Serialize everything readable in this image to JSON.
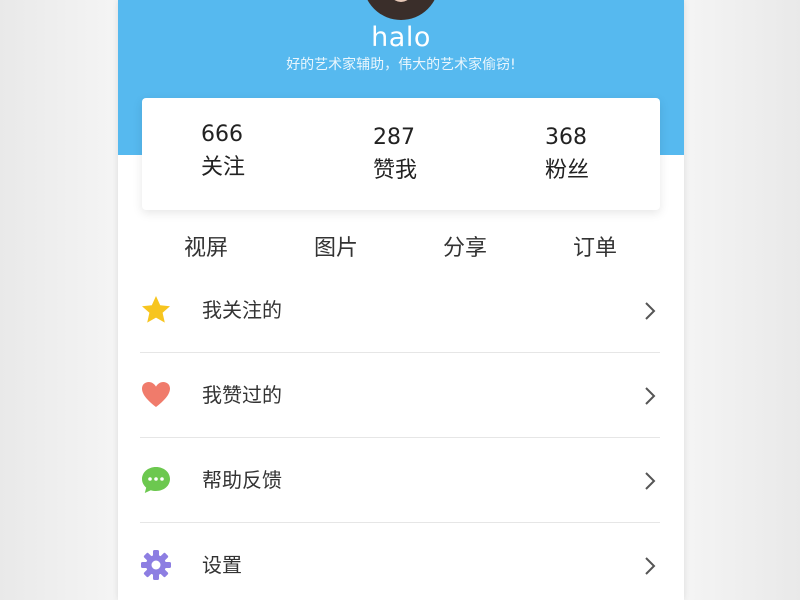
{
  "profile": {
    "username": "halo",
    "motto": "好的艺术家辅助，伟大的艺术家偷窃!"
  },
  "stats": [
    {
      "value": "666",
      "label": "关注"
    },
    {
      "value": "287",
      "label": "赞我"
    },
    {
      "value": "368",
      "label": "粉丝"
    }
  ],
  "tabs": [
    "视屏",
    "图片",
    "分享",
    "订单"
  ],
  "menu": [
    {
      "label": "我关注的",
      "icon": "star-icon",
      "color": "#f7c51f"
    },
    {
      "label": "我赞过的",
      "icon": "heart-icon",
      "color": "#f07b6b"
    },
    {
      "label": "帮助反馈",
      "icon": "chat-bubble-icon",
      "color": "#6cc84f"
    },
    {
      "label": "设置",
      "icon": "gear-icon",
      "color": "#8d7ee2"
    }
  ],
  "colors": {
    "header": "#56b9ef",
    "card": "#ffffff",
    "divider": "#e6e6e6"
  }
}
